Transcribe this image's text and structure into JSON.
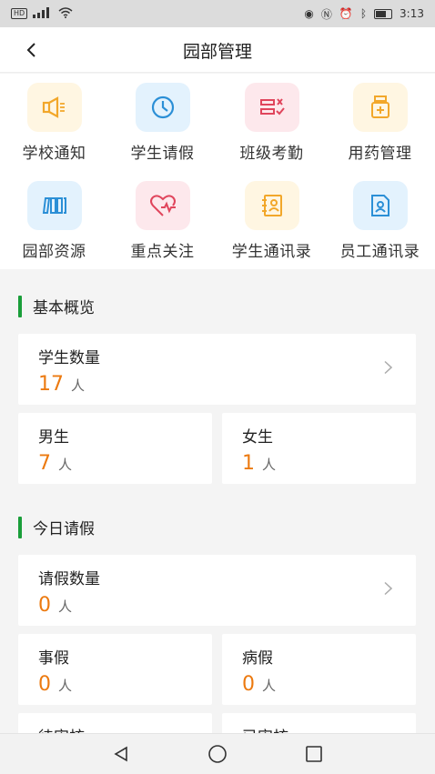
{
  "statusbar": {
    "time": "3:13",
    "network": "HD",
    "signal": "5G"
  },
  "header": {
    "title": "园部管理",
    "back_icon": "back-arrow-icon"
  },
  "menu": {
    "row1": [
      {
        "label": "学校通知",
        "icon": "megaphone-icon",
        "color": "#f2a72a",
        "bg": "#fff6e2"
      },
      {
        "label": "学生请假",
        "icon": "clock-icon",
        "color": "#2b8fd6",
        "bg": "#e3f2fd"
      },
      {
        "label": "班级考勤",
        "icon": "checklist-icon",
        "color": "#e0455c",
        "bg": "#fde8ec"
      },
      {
        "label": "用药管理",
        "icon": "medicine-bottle-icon",
        "color": "#f2a72a",
        "bg": "#fff6e2"
      }
    ],
    "row2": [
      {
        "label": "园部资源",
        "icon": "books-icon",
        "color": "#2b8fd6",
        "bg": "#e3f2fd"
      },
      {
        "label": "重点关注",
        "icon": "heart-pulse-icon",
        "color": "#e0455c",
        "bg": "#fde8ec"
      },
      {
        "label": "学生通讯录",
        "icon": "contact-book-icon",
        "color": "#f2a72a",
        "bg": "#fff6e2"
      },
      {
        "label": "员工通讯录",
        "icon": "staff-contact-icon",
        "color": "#2b8fd6",
        "bg": "#e3f2fd"
      }
    ]
  },
  "overview": {
    "title": "基本概览",
    "students": {
      "label": "学生数量",
      "value": "17",
      "unit": "人"
    },
    "male": {
      "label": "男生",
      "value": "7",
      "unit": "人"
    },
    "female": {
      "label": "女生",
      "value": "1",
      "unit": "人"
    }
  },
  "leave": {
    "title": "今日请假",
    "total": {
      "label": "请假数量",
      "value": "0",
      "unit": "人"
    },
    "personal": {
      "label": "事假",
      "value": "0",
      "unit": "人"
    },
    "sick": {
      "label": "病假",
      "value": "0",
      "unit": "人"
    },
    "pending": {
      "label": "待审核"
    },
    "approved": {
      "label": "已审核"
    }
  },
  "colors": {
    "accent": "#1a9e3a",
    "number": "#ec7a10"
  }
}
